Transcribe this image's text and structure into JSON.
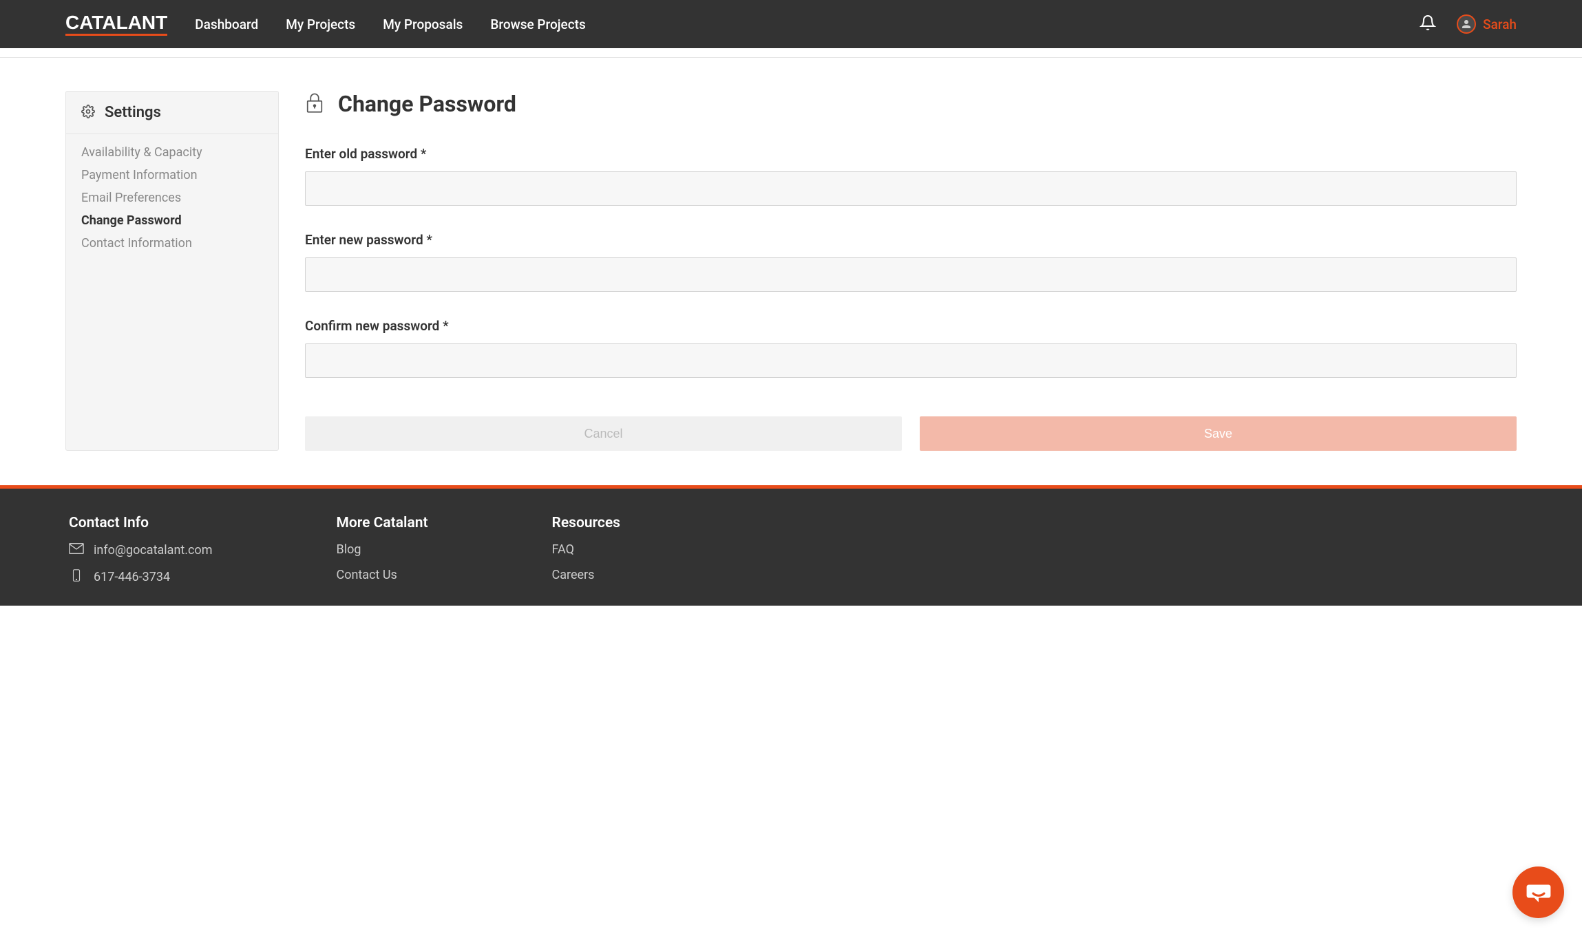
{
  "header": {
    "logo": "CATALANT",
    "nav": [
      {
        "label": "Dashboard"
      },
      {
        "label": "My Projects"
      },
      {
        "label": "My Proposals"
      },
      {
        "label": "Browse Projects"
      }
    ],
    "user_name": "Sarah"
  },
  "sidebar": {
    "title": "Settings",
    "items": [
      {
        "label": "Availability & Capacity",
        "active": false
      },
      {
        "label": "Payment Information",
        "active": false
      },
      {
        "label": "Email Preferences",
        "active": false
      },
      {
        "label": "Change Password",
        "active": true
      },
      {
        "label": "Contact Information",
        "active": false
      }
    ]
  },
  "page": {
    "title": "Change Password",
    "fields": {
      "old_password_label": "Enter old password *",
      "new_password_label": "Enter new password *",
      "confirm_password_label": "Confirm new password *"
    },
    "buttons": {
      "cancel": "Cancel",
      "save": "Save"
    }
  },
  "footer": {
    "contact": {
      "title": "Contact Info",
      "email": "info@gocatalant.com",
      "phone": "617-446-3734"
    },
    "more": {
      "title": "More Catalant",
      "links": [
        {
          "label": "Blog"
        },
        {
          "label": "Contact Us"
        }
      ]
    },
    "resources": {
      "title": "Resources",
      "links": [
        {
          "label": "FAQ"
        },
        {
          "label": "Careers"
        }
      ]
    }
  }
}
